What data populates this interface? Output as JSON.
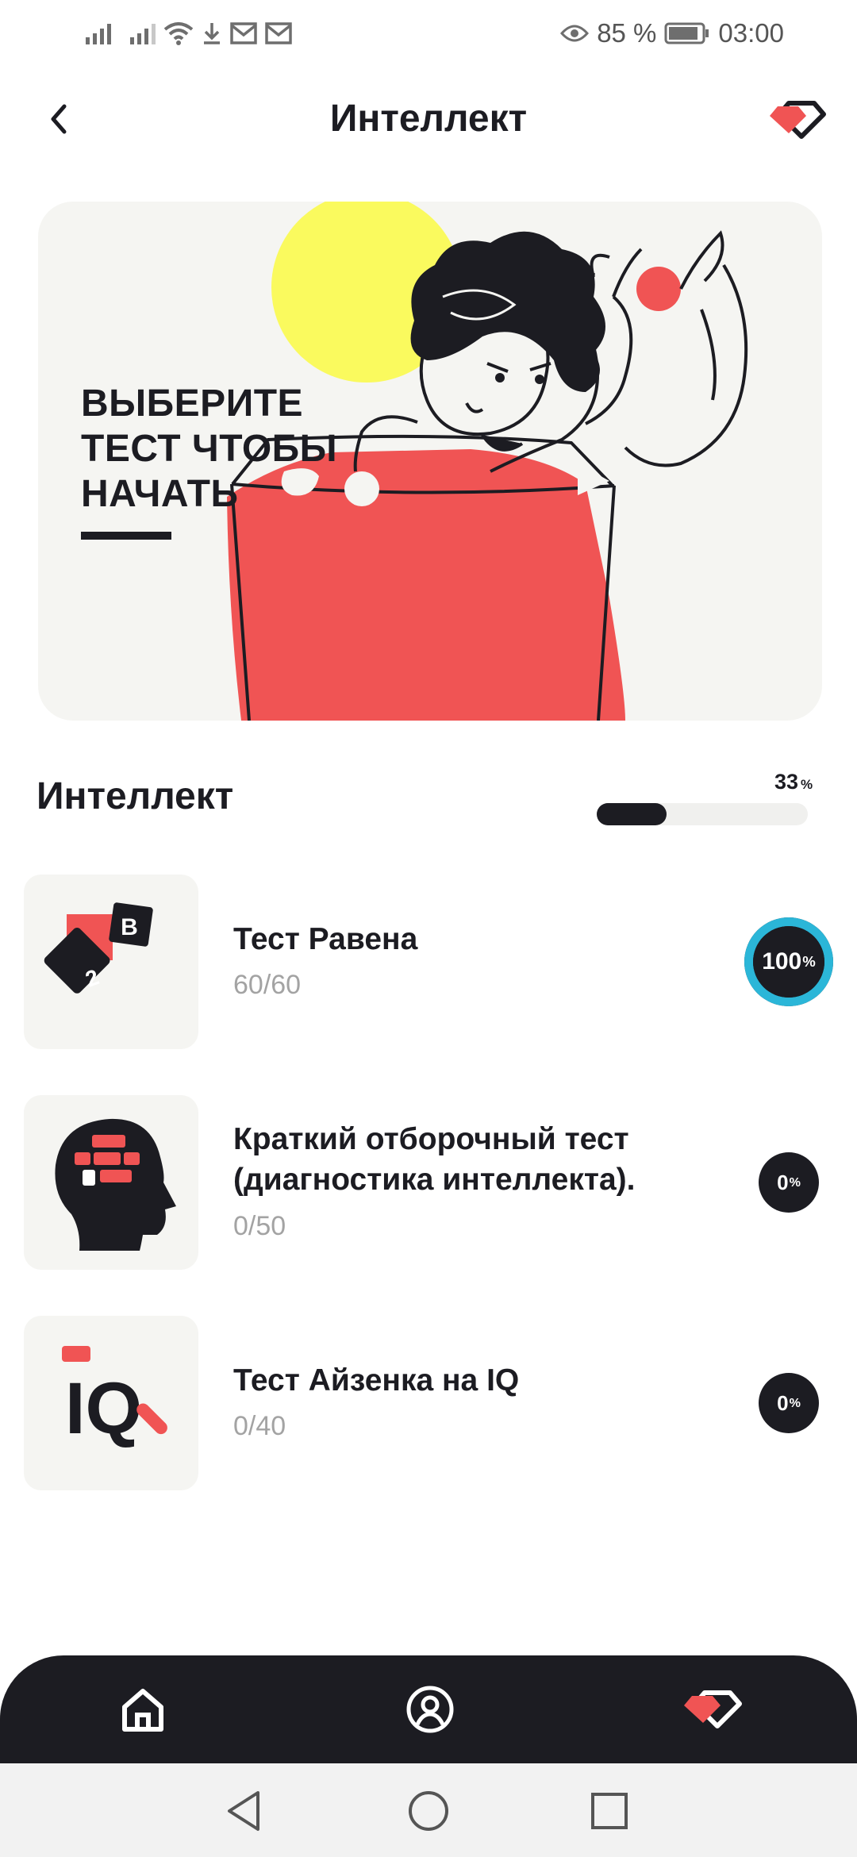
{
  "status_bar": {
    "battery": "85 %",
    "time": "03:00",
    "icons": [
      "signal-icon",
      "signal-icon",
      "wifi-icon",
      "download-icon",
      "mail-icon",
      "mail-icon",
      "eye-icon",
      "battery-icon"
    ]
  },
  "header": {
    "title": "Интеллект",
    "back_icon": "chevron-left-icon",
    "gem_icon": "gem-icon"
  },
  "hero": {
    "text": "Выберите тест чтобы начать"
  },
  "section": {
    "title": "Интеллект",
    "progress_value": "33",
    "progress_unit": "%",
    "progress_fraction": 0.33
  },
  "tests": [
    {
      "name": "Тест Равена",
      "count": "60/60",
      "percent_value": "100",
      "percent_unit": "%",
      "completed": true,
      "icon": "cubes-icon"
    },
    {
      "name": "Краткий отборочный тест (диагностика интеллекта).",
      "count": "0/50",
      "percent_value": "0",
      "percent_unit": "%",
      "completed": false,
      "icon": "head-bricks-icon"
    },
    {
      "name": "Тест Айзенка на IQ",
      "count": "0/40",
      "percent_value": "0",
      "percent_unit": "%",
      "completed": false,
      "icon": "iq-icon",
      "icon_text": "IQ"
    }
  ],
  "cube_letters": [
    "В",
    "2"
  ],
  "bottom_nav": {
    "items": [
      "home-icon",
      "profile-icon",
      "gem-icon"
    ]
  },
  "system_nav": [
    "back-triangle-icon",
    "home-circle-icon",
    "recent-square-icon"
  ],
  "colors": {
    "accent_red": "#f05454",
    "dark": "#1c1c22",
    "complete_ring": "#2bb6d8",
    "yellow": "#fafa5e",
    "card_bg": "#f5f5f2"
  }
}
